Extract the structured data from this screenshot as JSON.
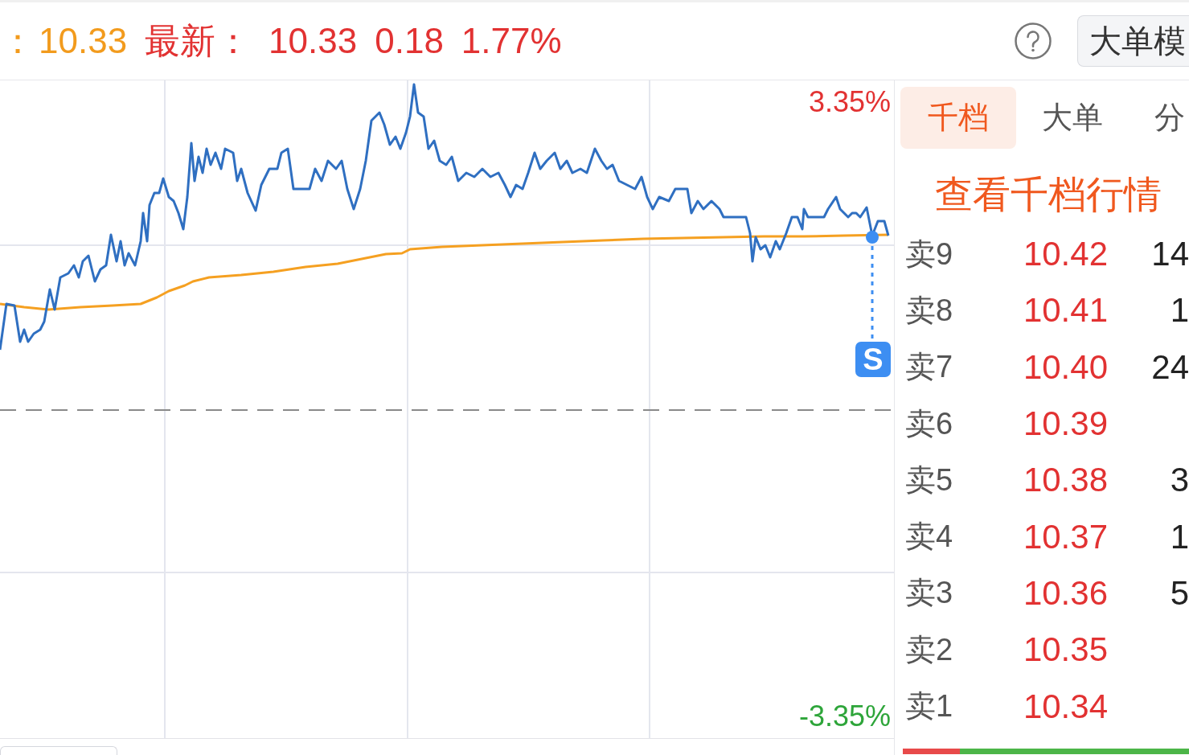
{
  "quote_bar": {
    "average_label": "：",
    "average_value": "10.33",
    "latest_label": "最新：",
    "latest_price": "10.33",
    "change": "0.18",
    "change_percent": "1.77%",
    "mode_button": "大单模"
  },
  "chart": {
    "upper_label": "3.35%",
    "lower_label": "-3.35%",
    "signal_label": "S"
  },
  "side_panel": {
    "tabs": [
      {
        "label": "千档",
        "selected": true
      },
      {
        "label": "大单",
        "selected": false
      },
      {
        "label": "分",
        "selected": false
      }
    ],
    "link": "查看千档行情",
    "asks": [
      {
        "label": "卖9",
        "price": "10.42",
        "volume": "14"
      },
      {
        "label": "卖8",
        "price": "10.41",
        "volume": "1"
      },
      {
        "label": "卖7",
        "price": "10.40",
        "volume": "24"
      },
      {
        "label": "卖6",
        "price": "10.39"
      },
      {
        "label": "卖5",
        "price": "10.38",
        "volume": "3"
      },
      {
        "label": "卖4",
        "price": "10.37",
        "volume": "1"
      },
      {
        "label": "卖3",
        "price": "10.36",
        "volume": "5"
      },
      {
        "label": "卖2",
        "price": "10.35"
      },
      {
        "label": "卖1",
        "price": "10.34"
      }
    ],
    "ratio_bar": {
      "level": 0.2
    }
  }
}
